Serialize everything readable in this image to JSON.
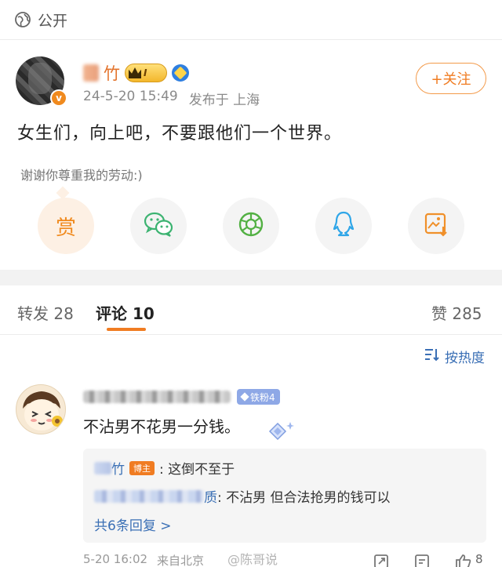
{
  "visibility": {
    "icon": "globe-icon",
    "label": "公开"
  },
  "post": {
    "author_name_visible": "竹",
    "member_level": "I",
    "timestamp": "24-5-20 15:49",
    "location": "发布于 上海",
    "follow_label": "+关注",
    "text": "女生们，向上吧，不要跟他们一个世界。",
    "reward_tip": "谢谢你尊重我的劳动:)",
    "share_actions": [
      {
        "name": "reward",
        "label": "赏",
        "icon": "reward-icon"
      },
      {
        "name": "wechat",
        "icon": "wechat-icon"
      },
      {
        "name": "moments",
        "icon": "moments-icon"
      },
      {
        "name": "qq",
        "icon": "qq-icon"
      },
      {
        "name": "save-image",
        "icon": "save-image-icon"
      }
    ]
  },
  "tabs": {
    "repost_label": "转发",
    "repost_count": "28",
    "comment_label": "评论",
    "comment_count": "10",
    "like_label": "赞",
    "like_count": "285"
  },
  "sort": {
    "label": "按热度",
    "icon": "sort-icon"
  },
  "comment": {
    "fan_badge": "铁粉4",
    "text": "不沾男不花男一分钱。",
    "replies": [
      {
        "author_visible": "竹",
        "badge": "博主",
        "text": ": 这倒不至于"
      },
      {
        "author_tail": "质",
        "text": ": 不沾男 但合法抢男的钱可以"
      }
    ],
    "more_replies": "共6条回复 >",
    "time": "5-20 16:02",
    "source": "来自北京",
    "like_count": "8"
  },
  "watermark": "@陈哥说",
  "colors": {
    "accent_orange": "#f07c22",
    "link_blue": "#3a6fb5",
    "wechat_green": "#3cb371",
    "moments_green": "#52b043",
    "qq_blue": "#2fa6e8",
    "save_orange": "#f0902a"
  }
}
